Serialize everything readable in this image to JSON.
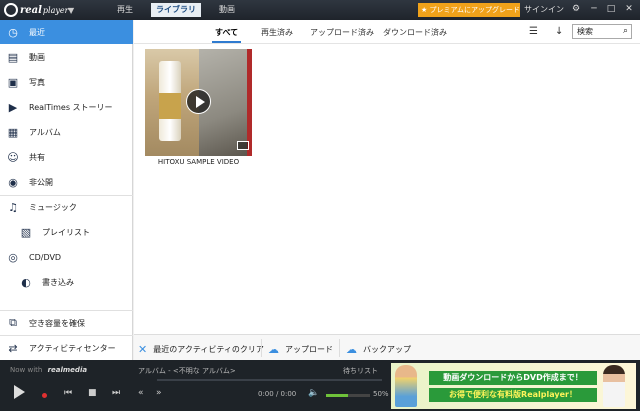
{
  "app": {
    "name": "real",
    "name_sub": "player"
  },
  "tabs": [
    {
      "label": "再生"
    },
    {
      "label": "ライブラリ"
    },
    {
      "label": "動画"
    }
  ],
  "premium_label": "★ プレミアムにアップグレード",
  "signin_label": "サインイン",
  "sidebar": {
    "items": [
      {
        "label": "最近",
        "icon": "clock-icon",
        "active": true
      },
      {
        "label": "動画",
        "icon": "film-icon"
      },
      {
        "label": "写真",
        "icon": "photo-icon"
      },
      {
        "label": "RealTimes ストーリー",
        "icon": "play-story-icon"
      },
      {
        "label": "アルバム",
        "icon": "album-icon"
      },
      {
        "label": "共有",
        "icon": "people-icon"
      },
      {
        "label": "非公開",
        "icon": "eye-hidden-icon"
      },
      {
        "label": "ミュージック",
        "icon": "music-note-icon"
      },
      {
        "label": "プレイリスト",
        "icon": "playlist-icon"
      },
      {
        "label": "CD/DVD",
        "icon": "disc-icon"
      },
      {
        "label": "書き込み",
        "icon": "burn-icon"
      }
    ],
    "footer": [
      {
        "label": "空き容量を確保",
        "icon": "free-space-icon"
      },
      {
        "label": "アクティビティセンター",
        "icon": "activity-icon"
      }
    ]
  },
  "filters": [
    {
      "label": "すべて",
      "active": true
    },
    {
      "label": "再生済み"
    },
    {
      "label": "アップロード済み"
    },
    {
      "label": "ダウンロード済み"
    }
  ],
  "search": {
    "placeholder": "検索"
  },
  "video": {
    "title": "HITOXU SAMPLE VIDEO"
  },
  "actions": [
    {
      "label": "最近のアクティビティのクリア",
      "icon": "clear-icon"
    },
    {
      "label": "アップロード",
      "icon": "cloud-upload-icon"
    },
    {
      "label": "バックアップ",
      "icon": "cloud-backup-icon"
    }
  ],
  "player": {
    "now_with": "Now with",
    "brand": "realmedia",
    "album": "アルバム - <不明な アルバム>",
    "queue": "待ちリスト",
    "time": "0:00 / 0:00",
    "volume_percent": 50,
    "volume_label": "50%"
  },
  "ad": {
    "line1": "動画ダウンロードからDVD作成まで！",
    "line2": "お得で便利な有料版Realplayer！"
  },
  "colors": {
    "accent": "#3b8fe0",
    "premium": "#f0a21a",
    "player_bg": "#1e2328"
  }
}
